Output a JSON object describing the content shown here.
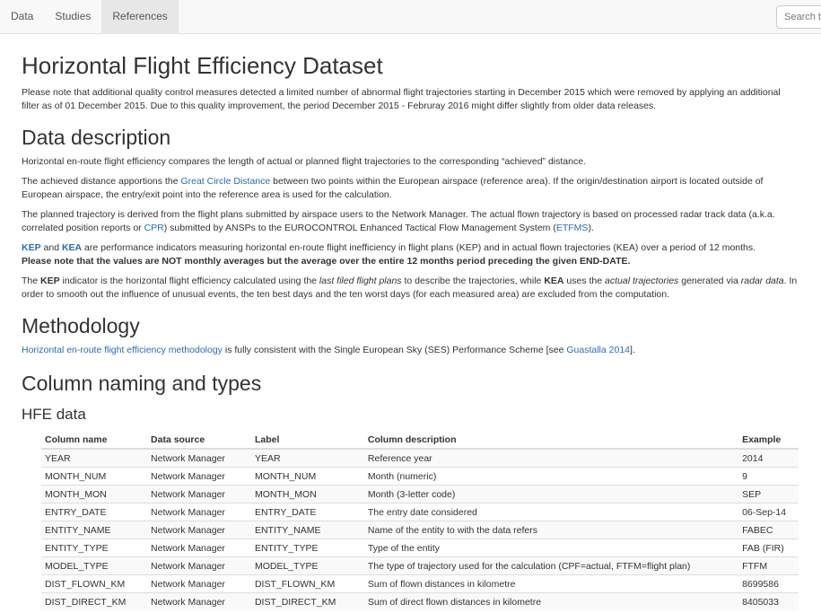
{
  "nav": {
    "tabs": [
      {
        "label": "Data",
        "active": false
      },
      {
        "label": "Studies",
        "active": false
      },
      {
        "label": "References",
        "active": true
      }
    ],
    "search_placeholder": "Search t"
  },
  "page_title": "Horizontal Flight Efficiency Dataset",
  "notice": "Please note that additional quality control measures detected a limited number of abnormal flight trajectories starting in December 2015 which were removed by applying an additional filter as of 01 December 2015. Due to this quality improvement, the period December 2015 - Februray 2016 might differ slightly from older data releases.",
  "data_description": {
    "heading": "Data description",
    "p1": "Horizontal en-route flight efficiency compares the length of actual or planned flight trajectories to the corresponding “achieved” distance.",
    "p2_a": "The achieved distance apportions the ",
    "p2_link": "Great Circle Distance",
    "p2_b": " between two points within the European airspace (reference area). If the origin/destination airport is located outside of European airspace, the entry/exit point into the reference area is used for the calculation.",
    "p3_a": "The planned trajectory is derived from the flight plans submitted by airspace users to the Network Manager. The actual flown trajectory is based on processed radar track data (a.k.a. correlated position reports or ",
    "p3_link1": "CPR",
    "p3_b": ") submitted by ANSPs to the EUROCONTROL Enhanced Tactical Flow Management System (",
    "p3_link2": "ETFMS",
    "p3_c": ").",
    "p4_link1": "KEP",
    "p4_a": " and ",
    "p4_link2": "KEA",
    "p4_b": " are performance indicators measuring horizontal en-route flight inefficiency in flight plans (KEP) and in actual flown trajectories (KEA) over a period of 12 months.",
    "p4_bold": "Please note that the values are NOT monthly averages but the average over the entire 12 months period preceding the given END-DATE.",
    "p5_a": "The ",
    "p5_b1": "KEP",
    "p5_b": " indicator is the horizontal flight efficiency calculated using the ",
    "p5_i1": "last filed flight plans",
    "p5_c": " to describe the trajectories, while ",
    "p5_b2": "KEA",
    "p5_d": " uses the ",
    "p5_i2": "actual trajectories",
    "p5_e": " generated via ",
    "p5_i3": "radar data",
    "p5_f": ". In order to smooth out the influence of unusual events, the ten best days and the ten worst days (for each measured area) are excluded from the computation."
  },
  "methodology": {
    "heading": "Methodology",
    "link1": "Horizontal en-route flight efficiency methodology",
    "text_a": " is fully consistent with the Single European Sky (SES) Performance Scheme [see ",
    "link2": "Guastalla 2014",
    "text_b": "]."
  },
  "columns_heading": "Column naming and types",
  "hfe_heading": "HFE data",
  "table": {
    "headers": [
      "Column name",
      "Data source",
      "Label",
      "Column description",
      "Example"
    ],
    "rows": [
      [
        "YEAR",
        "Network Manager",
        "YEAR",
        "Reference year",
        "2014"
      ],
      [
        "MONTH_NUM",
        "Network Manager",
        "MONTH_NUM",
        "Month (numeric)",
        "9"
      ],
      [
        "MONTH_MON",
        "Network Manager",
        "MONTH_MON",
        "Month (3-letter code)",
        "SEP"
      ],
      [
        "ENTRY_DATE",
        "Network Manager",
        "ENTRY_DATE",
        "The entry date considered",
        "06-Sep-14"
      ],
      [
        "ENTITY_NAME",
        "Network Manager",
        "ENTITY_NAME",
        "Name of the entity to with the data refers",
        "FABEC"
      ],
      [
        "ENTITY_TYPE",
        "Network Manager",
        "ENTITY_TYPE",
        "Type of the entity",
        "FAB (FIR)"
      ],
      [
        "MODEL_TYPE",
        "Network Manager",
        "MODEL_TYPE",
        "The type of trajectory used for the calculation (CPF=actual, FTFM=flight plan)",
        "FTFM"
      ],
      [
        "DIST_FLOWN_KM",
        "Network Manager",
        "DIST_FLOWN_KM",
        "Sum of flown distances in kilometre",
        "8699586"
      ],
      [
        "DIST_DIRECT_KM",
        "Network Manager",
        "DIST_DIRECT_KM",
        "Sum of direct flown distances in kilometre",
        "8405033"
      ]
    ]
  }
}
